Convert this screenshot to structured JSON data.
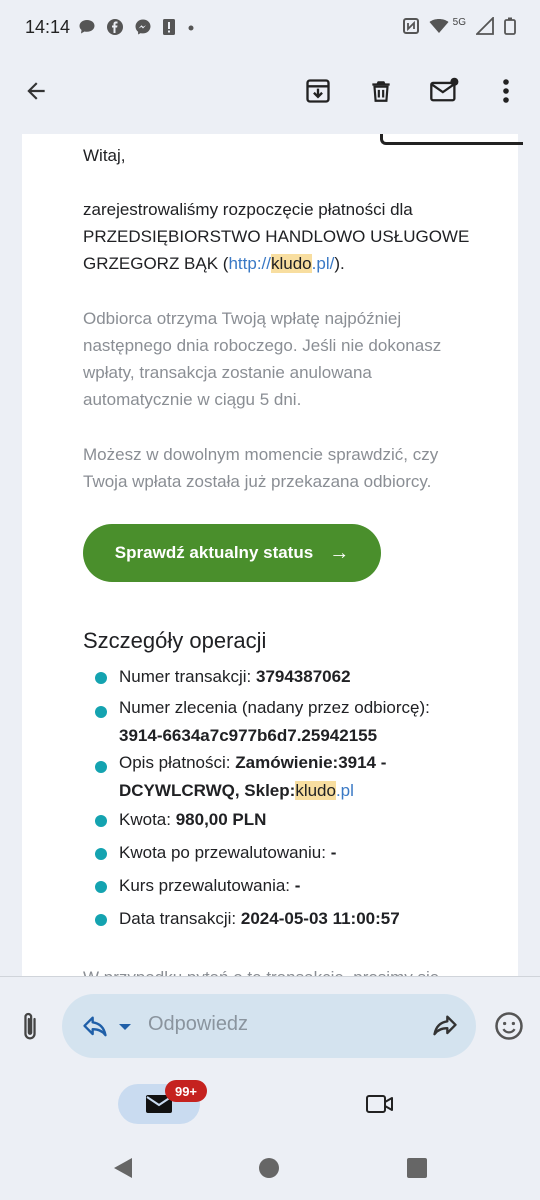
{
  "status_bar": {
    "time": "14:14",
    "left_icons": [
      "chat-bubble-icon",
      "facebook-icon",
      "messenger-icon",
      "alert-icon",
      "dot-icon"
    ],
    "right_icons": [
      "nfc-icon",
      "wifi-icon",
      "signal-5g-icon",
      "signal-icon",
      "battery-icon"
    ],
    "network_label": "5G"
  },
  "toolbar": {
    "back_icon": "arrow-left-icon",
    "archive_icon": "archive-icon",
    "delete_icon": "trash-icon",
    "mark_unread_icon": "mail-unread-icon",
    "more_icon": "more-vert-icon"
  },
  "email": {
    "greeting": "Witaj,",
    "intro_line1": "zarejestrowaliśmy rozpoczęcie płatności dla",
    "intro_line2": "PRZEDSIĘBIORSTWO HANDLOWO USŁUGOWE",
    "intro_line3_prefix": "GRZEGORZ BĄK (",
    "link_part1": "http://",
    "link_highlight": "kludo",
    "link_part2": ".pl/",
    "intro_line3_suffix": ").",
    "para2_line1": "Odbiorca otrzyma Twoją wpłatę najpóźniej",
    "para2_line2": "następnego dnia roboczego. Jeśli nie dokonasz",
    "para2_line3": "wpłaty, transakcja zostanie anulowana",
    "para2_line4": "automatycznie w ciągu 5 dni.",
    "para3_line1": "Możesz w dowolnym momencie sprawdzić, czy",
    "para3_line2": "Twoja wpłata została już przekazana odbiorcy.",
    "status_button": "Sprawdź aktualny status",
    "status_button_arrow": "→",
    "details_title": "Szczegóły operacji",
    "details": {
      "tx_number_label": "Numer transakcji: ",
      "tx_number_value": "3794387062",
      "order_label": "Numer zlecenia (nadany przez odbiorcę):",
      "order_value": "3914-6634a7c977b6d7.25942155",
      "desc_label": "Opis płatności: ",
      "desc_value_line1": "Zamówienie:3914 -",
      "desc_value_line2_prefix": "DCYWLCRWQ, Sklep:",
      "desc_value_highlight": "kludo",
      "desc_value_link": ".pl",
      "amount_label": "Kwota: ",
      "amount_value": "980,00 PLN",
      "converted_label": "Kwota po przewalutowaniu: ",
      "converted_value": "-",
      "rate_label": "Kurs przewalutowania: ",
      "rate_value": "-",
      "date_label": "Data transakcji: ",
      "date_value": "2024-05-03 11:00:57"
    },
    "cut_off_line": "W przypadku pytań o tę transakcję, prosimy się"
  },
  "reply_bar": {
    "attach_icon": "paperclip-icon",
    "reply_icon": "reply-icon",
    "dropdown_icon": "caret-down-icon",
    "placeholder": "Odpowiedz",
    "forward_icon": "forward-icon",
    "emoji_icon": "emoji-icon"
  },
  "bottom_nav": {
    "mail_icon": "mail-icon",
    "mail_badge": "99+",
    "meet_icon": "video-icon"
  },
  "system_nav": {
    "back": "triangle-back-icon",
    "home": "circle-home-icon",
    "recents": "square-recents-icon"
  },
  "colors": {
    "accent_green": "#4a8f2c",
    "bullet_teal": "#14a3b0",
    "link_blue": "#3a79c5",
    "highlight": "#f8dea0",
    "badge_red": "#C5221F"
  }
}
